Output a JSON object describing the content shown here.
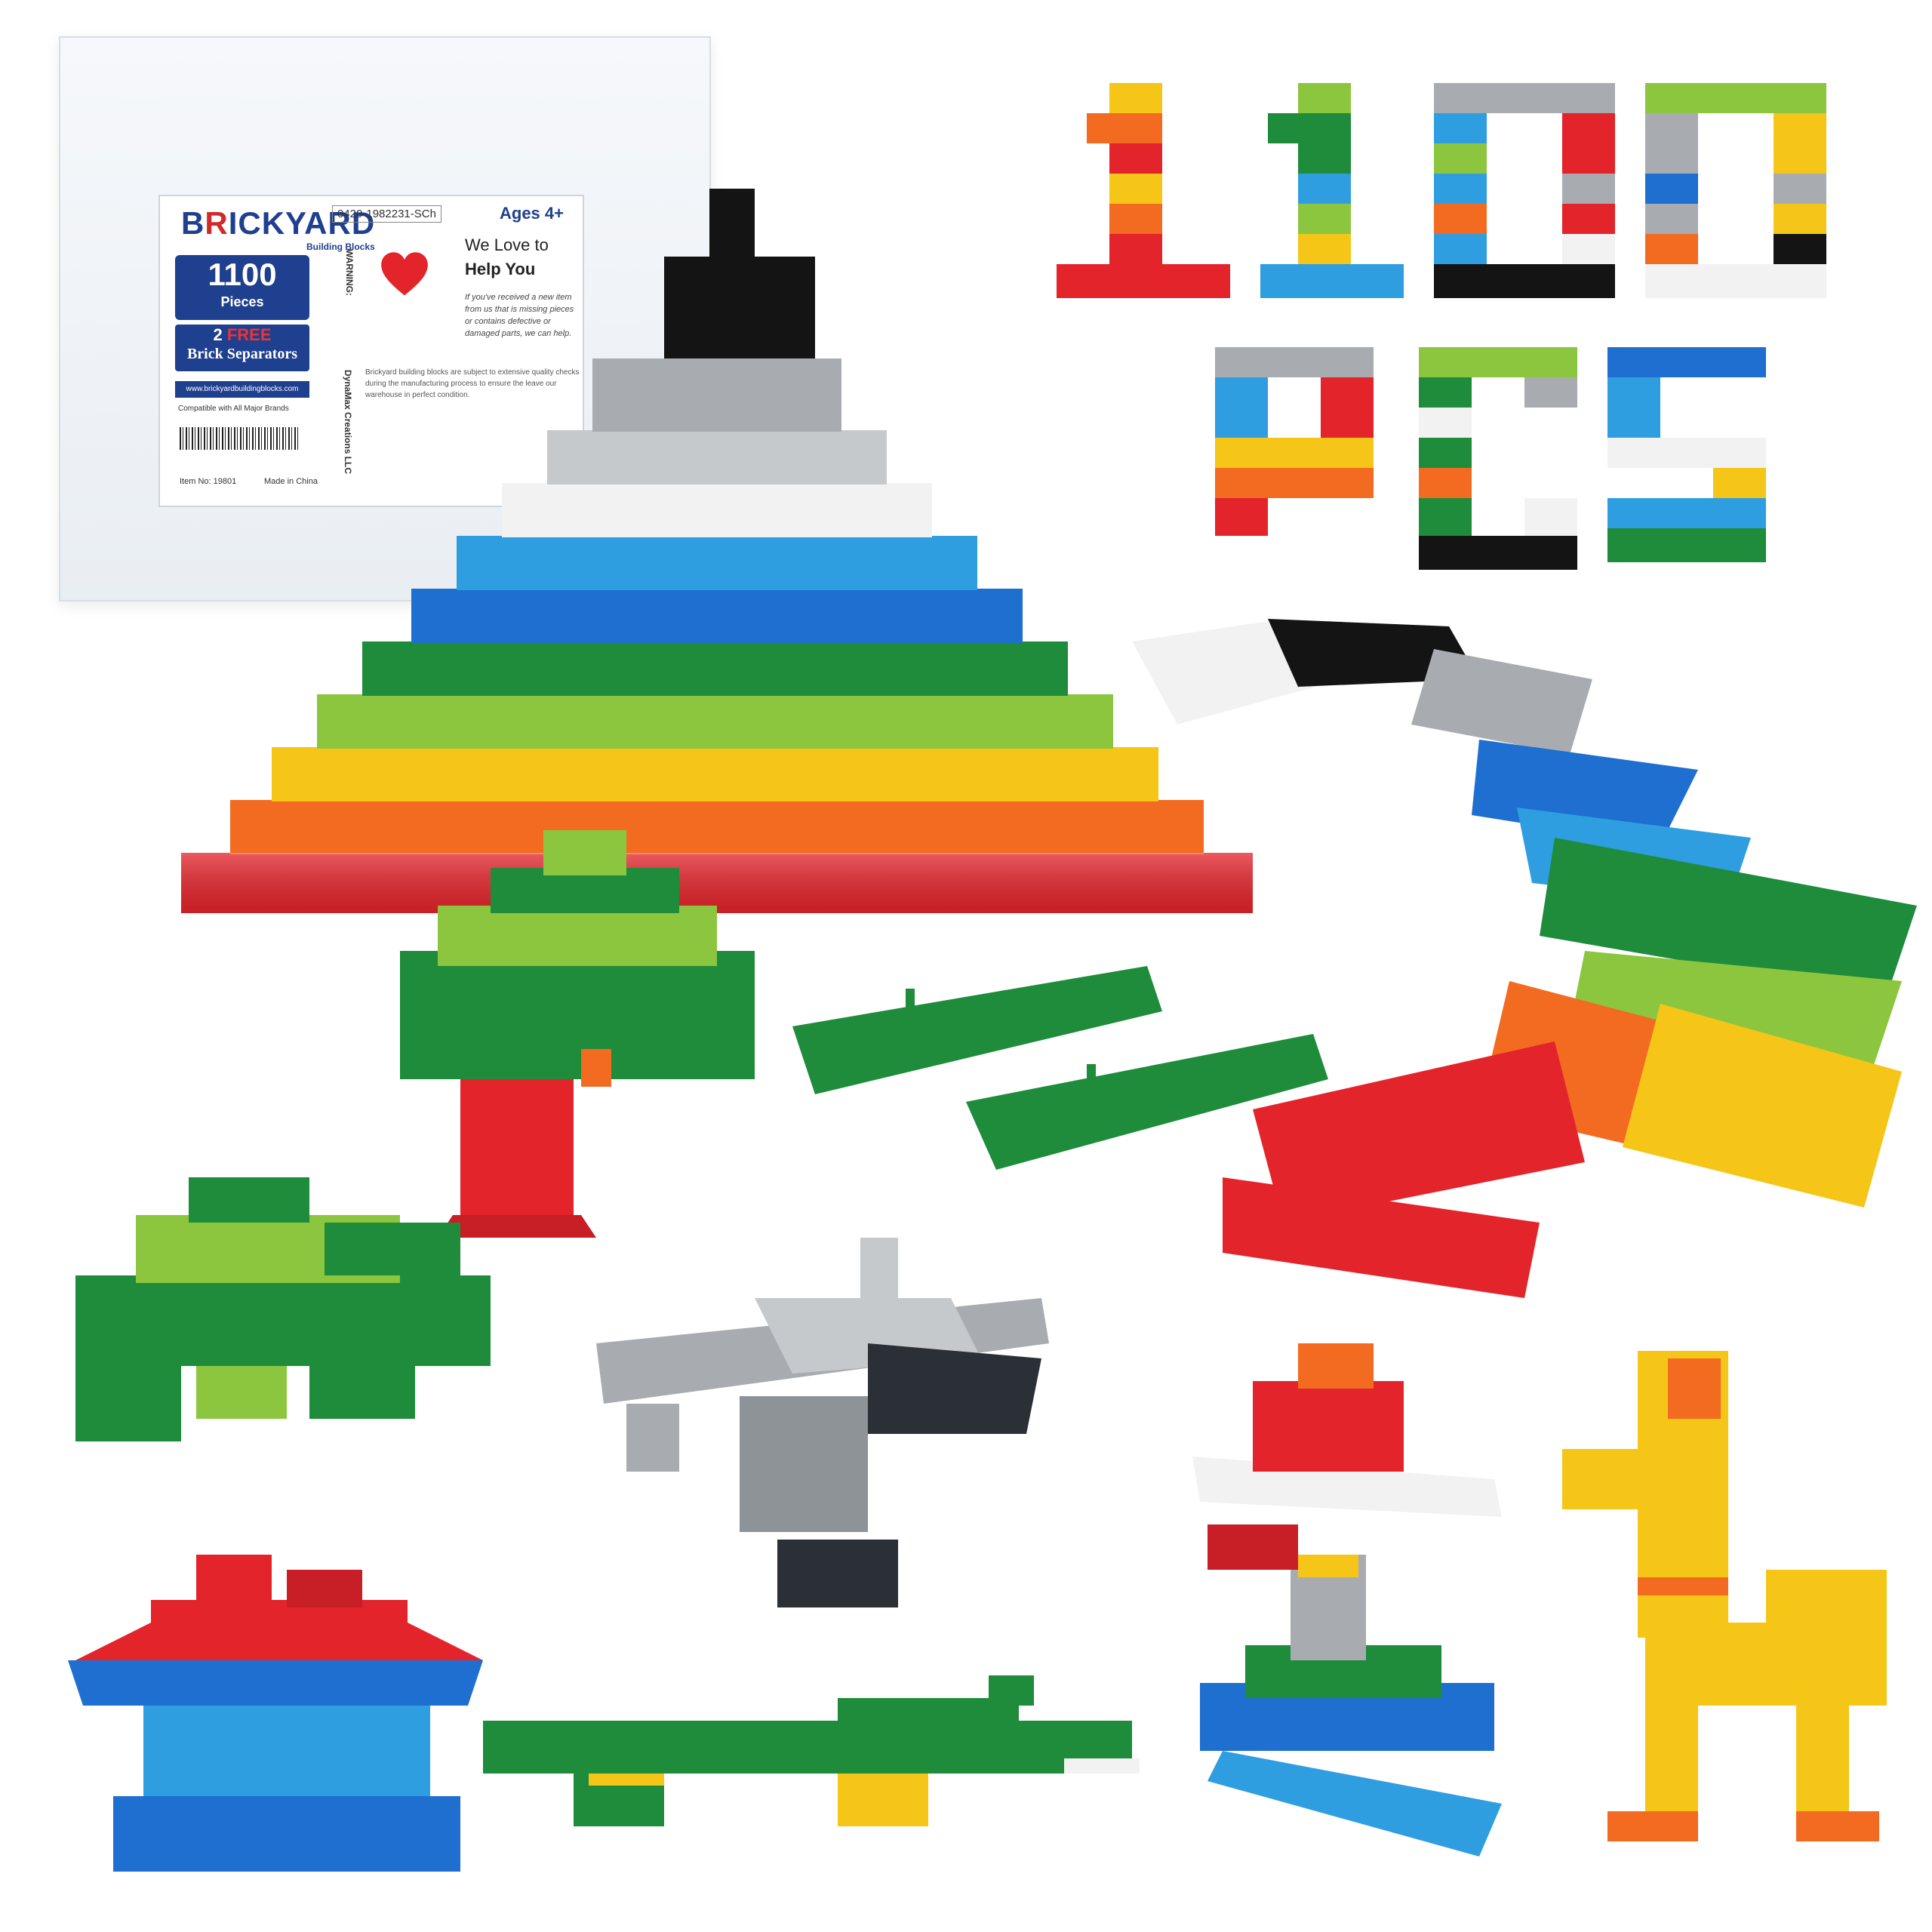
{
  "box": {
    "brand_prefix": "B",
    "brand_r": "R",
    "brand_rest": "ICKYARD",
    "brand_sub": "Building Blocks",
    "sku": "0420-1982231-SCh",
    "ages": "Ages 4+",
    "pieces_number": "1100",
    "pieces_label": "Pieces",
    "free_count": "2",
    "free_word": "FREE",
    "free_item": "Brick Separators",
    "website": "www.brickyardbuildingblocks.com",
    "compatible": "Compatible with All Major Brands",
    "item_no": "Item No: 19801",
    "made_in": "Made in China",
    "love_line": "We Love to",
    "help_line": "Help You",
    "blurb": "If you've received a new item from us that is missing pieces or contains defective or damaged parts, we can help.",
    "blurb2": "Brickyard building blocks are subject to extensive quality checks during the manufacturing process to ensure the leave our warehouse in perfect condition.",
    "warning_label": "WARNING:",
    "dynamax": "DynaMax Creations LLC"
  },
  "title_text": {
    "line1": [
      "1",
      "1",
      "0",
      "0"
    ],
    "line2": [
      "P",
      "C",
      "S"
    ]
  },
  "separator_brand": "BRICKYARD",
  "colors": {
    "red": "#e3242b",
    "orange": "#f26b21",
    "yellow": "#f5c518",
    "lime": "#8cc63f",
    "green": "#1e8c3a",
    "blue": "#1e6fd0",
    "sky": "#2f9ee0",
    "white": "#f2f2f2",
    "gray": "#a8acb0",
    "black": "#141414",
    "brand_blue": "#1f3f8f"
  }
}
